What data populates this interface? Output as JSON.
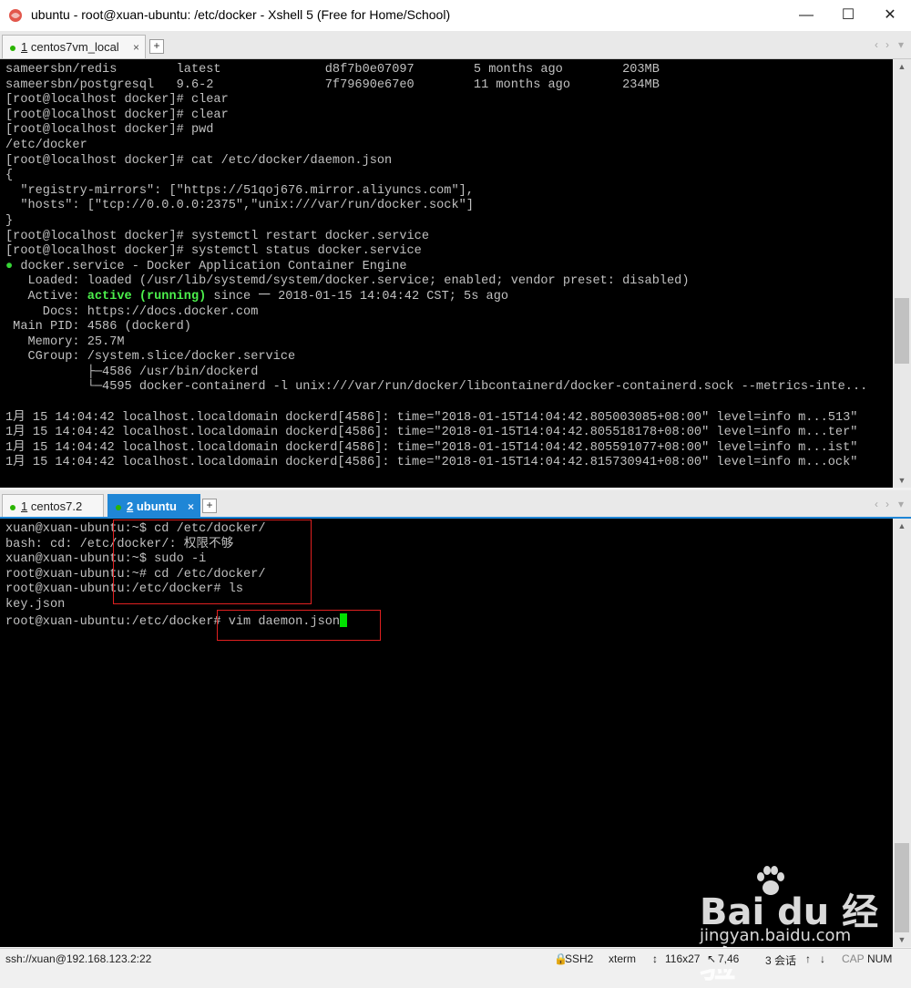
{
  "window": {
    "title": "ubuntu - root@xuan-ubuntu: /etc/docker - Xshell 5 (Free for Home/School)",
    "minimize_glyph": "—",
    "maximize_glyph": "☐",
    "close_glyph": "✕"
  },
  "top_pane": {
    "tab": {
      "number": "1",
      "label": "centos7vm_local",
      "close": "×"
    },
    "add_tab": "+",
    "lines": [
      "sameersbn/redis        latest              d8f7b0e07097        5 months ago        203MB",
      "sameersbn/postgresql   9.6-2               7f79690e67e0        11 months ago       234MB",
      "[root@localhost docker]# clear",
      "[root@localhost docker]# clear",
      "[root@localhost docker]# pwd",
      "/etc/docker",
      "[root@localhost docker]# cat /etc/docker/daemon.json",
      "{",
      "  \"registry-mirrors\": [\"https://51qoj676.mirror.aliyuncs.com\"],",
      "  \"hosts\": [\"tcp://0.0.0.0:2375\",\"unix:///var/run/docker.sock\"]",
      "}",
      "[root@localhost docker]# systemctl restart docker.service",
      "[root@localhost docker]# systemctl status docker.service"
    ],
    "status": {
      "bullet": "●",
      "service_line": " docker.service - Docker Application Container Engine",
      "loaded": "   Loaded: loaded (/usr/lib/systemd/system/docker.service; enabled; vendor preset: disabled)",
      "active_prefix": "   Active: ",
      "active_state": "active (running)",
      "active_suffix": " since 一 2018-01-15 14:04:42 CST; 5s ago",
      "docs": "     Docs: https://docs.docker.com",
      "main_pid": " Main PID: 4586 (dockerd)",
      "memory": "   Memory: 25.7M",
      "cgroup": "   CGroup: /system.slice/docker.service",
      "cg1": "           ├─4586 /usr/bin/dockerd",
      "cg2": "           └─4595 docker-containerd -l unix:///var/run/docker/libcontainerd/docker-containerd.sock --metrics-inte..."
    },
    "log_lines": [
      "1月 15 14:04:42 localhost.localdomain dockerd[4586]: time=\"2018-01-15T14:04:42.805003085+08:00\" level=info m...513\"",
      "1月 15 14:04:42 localhost.localdomain dockerd[4586]: time=\"2018-01-15T14:04:42.805518178+08:00\" level=info m...ter\"",
      "1月 15 14:04:42 localhost.localdomain dockerd[4586]: time=\"2018-01-15T14:04:42.805591077+08:00\" level=info m...ist\"",
      "1月 15 14:04:42 localhost.localdomain dockerd[4586]: time=\"2018-01-15T14:04:42.815730941+08:00\" level=info m...ock\""
    ]
  },
  "bottom_pane": {
    "tabs": [
      {
        "number": "1",
        "label": "centos7.2"
      },
      {
        "number": "2",
        "label": "ubuntu",
        "close": "×"
      }
    ],
    "add_tab": "+",
    "lines": [
      "xuan@xuan-ubuntu:~$ cd /etc/docker/",
      "bash: cd: /etc/docker/: 权限不够",
      "xuan@xuan-ubuntu:~$ sudo -i",
      "root@xuan-ubuntu:~# cd /etc/docker/",
      "root@xuan-ubuntu:/etc/docker# ls",
      "key.json"
    ],
    "prompt_line": "root@xuan-ubuntu:/etc/docker# vim daemon.json"
  },
  "statusbar": {
    "connection": "ssh://xuan@192.168.123.2:22",
    "protocol": "SSH2",
    "terminal": "xterm",
    "size": "116x27",
    "cursor_pos": "7,46",
    "sessions": "3 会话",
    "caps": "CAP",
    "num": "NUM"
  },
  "watermark": {
    "logo": "Bai du 经验",
    "url": "jingyan.baidu.com"
  },
  "colors": {
    "tab_active": "#1f86d6",
    "terminal_bg": "#000000",
    "terminal_fg": "#c0c0c0",
    "green": "#36d536",
    "highlight_box": "#e02020"
  }
}
